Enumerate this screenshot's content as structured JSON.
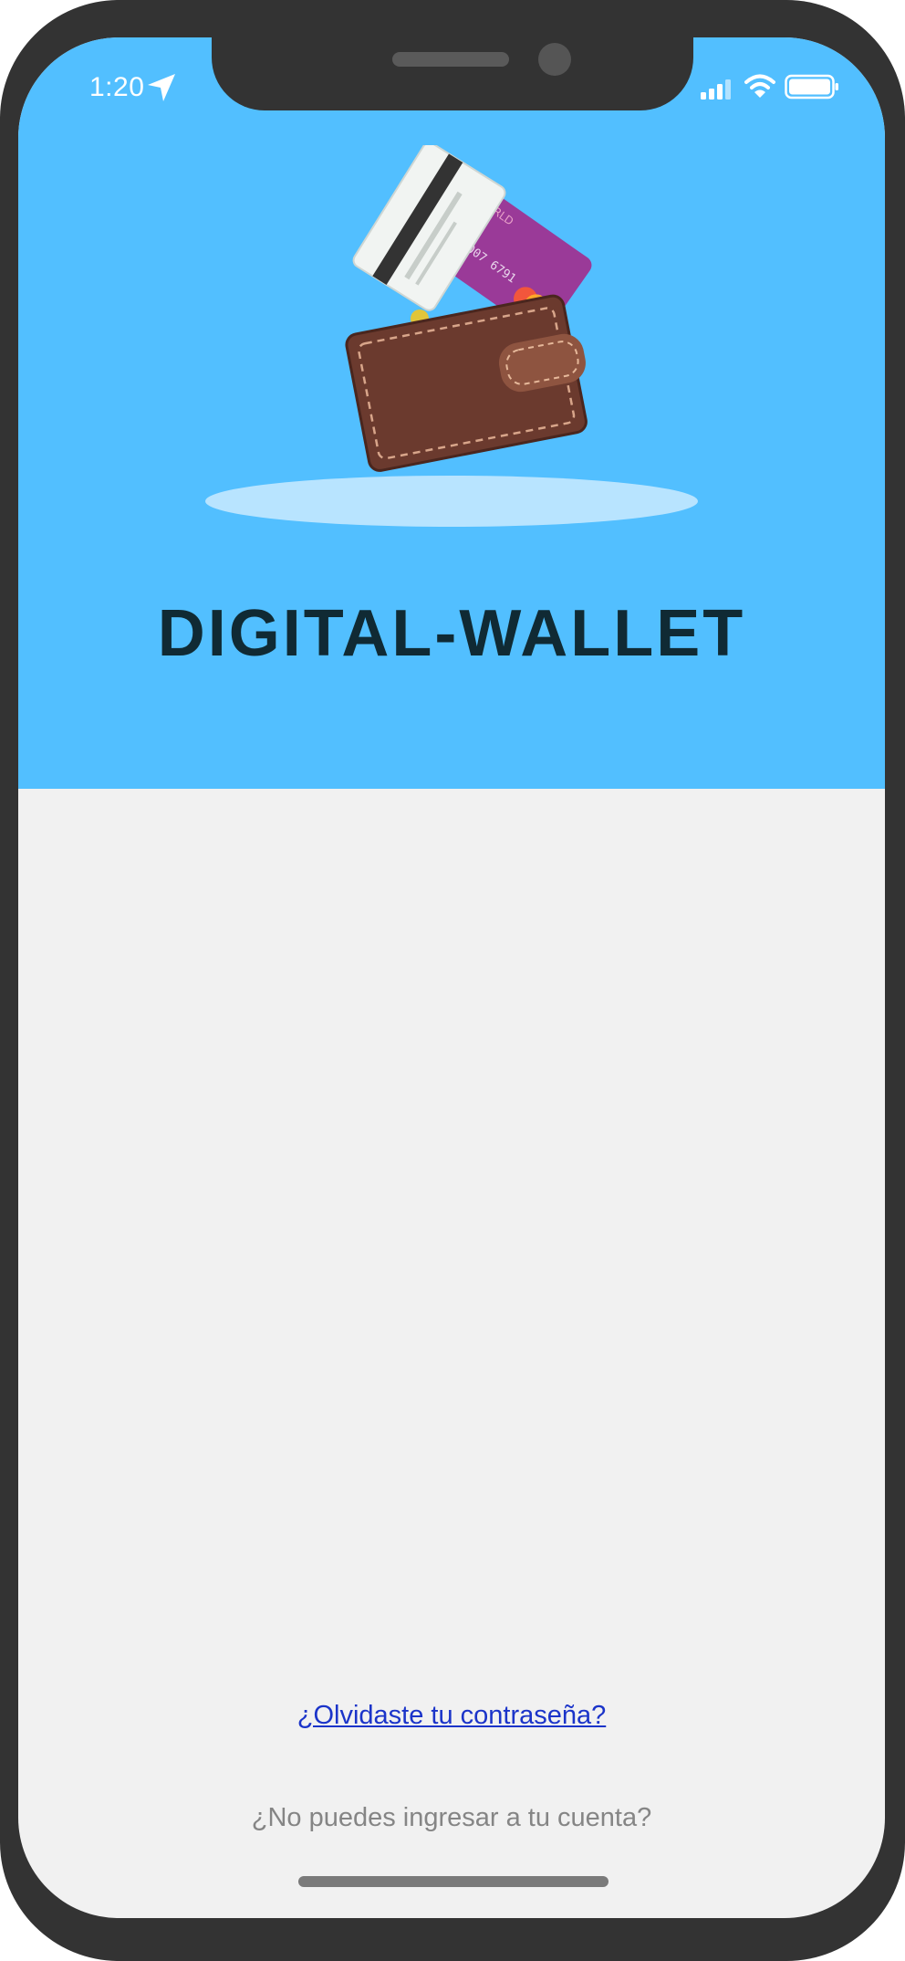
{
  "status_bar": {
    "time": "1:20",
    "icons": [
      "location-arrow-icon",
      "signal-icon",
      "wifi-icon",
      "battery-icon"
    ]
  },
  "hero": {
    "background_color": "#52bfff",
    "illustration": "wallet-with-cards-icon",
    "title": "DIGITAL-WALLET",
    "card_number_fragment": "0007 6791",
    "card_brand_fragment": "RLD"
  },
  "links": {
    "forgot_password": "¿Olvidaste tu contraseña?",
    "cant_login": "¿No puedes ingresar a tu cuenta?"
  },
  "colors": {
    "frame": "#333333",
    "screen_bg": "#f1f1f1",
    "title": "#102a34",
    "link": "#1b34c9",
    "muted_text": "#858585"
  }
}
